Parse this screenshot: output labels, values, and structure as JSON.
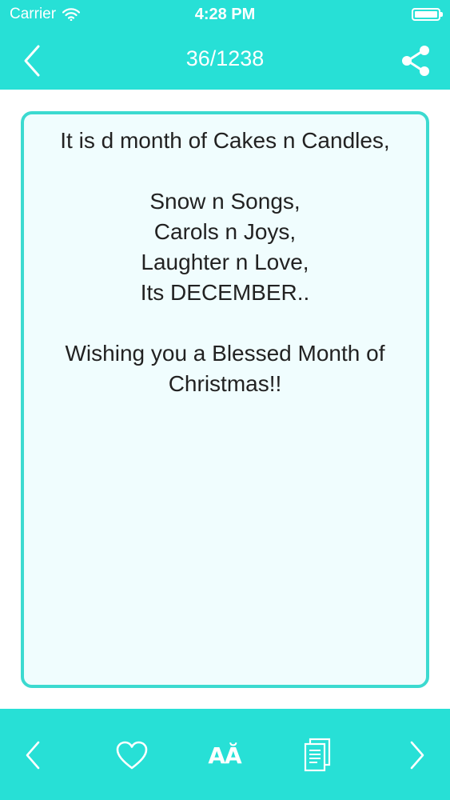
{
  "status_bar": {
    "carrier": "Carrier",
    "time": "4:28 PM",
    "wifi_icon": "wifi-icon",
    "battery_icon": "battery-icon"
  },
  "nav": {
    "back_icon": "chevron-left-icon",
    "title": "36/1238",
    "share_icon": "share-icon"
  },
  "message": {
    "line1": "It is d month of Cakes n Candles,",
    "line2": "Snow n Songs,",
    "line3": "Carols n Joys,",
    "line4": "Laughter n Love,",
    "line5": "Its DECEMBER..",
    "line6": "Wishing you a Blessed Month of Christmas!!"
  },
  "toolbar": {
    "prev_icon": "chevron-left-icon",
    "favorite_icon": "heart-icon",
    "font_label": "AĂ",
    "copy_icon": "document-icon",
    "next_icon": "chevron-right-icon"
  },
  "colors": {
    "accent": "#27e0d6",
    "card_border": "#3cdad0",
    "card_background": "#f0fdfe",
    "text": "#222222"
  }
}
